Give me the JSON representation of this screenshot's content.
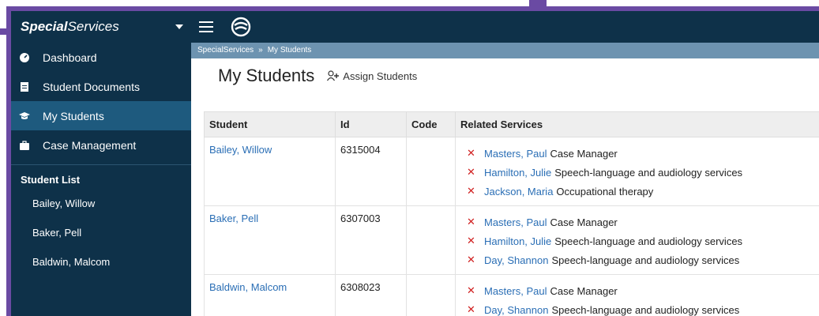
{
  "brand": {
    "name_bold": "Special",
    "name_rest": "Services"
  },
  "sidebar": {
    "items": [
      {
        "label": "Dashboard",
        "icon": "dashboard-icon"
      },
      {
        "label": "Student Documents",
        "icon": "document-icon"
      },
      {
        "label": "My Students",
        "icon": "graduation-cap-icon",
        "active": true
      },
      {
        "label": "Case Management",
        "icon": "briefcase-icon"
      }
    ],
    "list_title": "Student List",
    "students": [
      "Bailey, Willow",
      "Baker, Pell",
      "Baldwin, Malcom"
    ]
  },
  "breadcrumb": {
    "root": "SpecialServices",
    "sep": "»",
    "current": "My Students"
  },
  "page": {
    "title": "My Students",
    "assign_label": "Assign Students"
  },
  "table": {
    "headers": [
      "Student",
      "Id",
      "Code",
      "Related Services"
    ],
    "rows": [
      {
        "student": "Bailey, Willow",
        "id": "6315004",
        "code": "",
        "services": [
          {
            "name": "Masters, Paul",
            "desc": "Case Manager"
          },
          {
            "name": "Hamilton, Julie",
            "desc": "Speech-language and audiology services"
          },
          {
            "name": "Jackson, Maria",
            "desc": "Occupational therapy"
          }
        ]
      },
      {
        "student": "Baker, Pell",
        "id": "6307003",
        "code": "",
        "services": [
          {
            "name": "Masters, Paul",
            "desc": "Case Manager"
          },
          {
            "name": "Hamilton, Julie",
            "desc": "Speech-language and audiology services"
          },
          {
            "name": "Day, Shannon",
            "desc": "Speech-language and audiology services"
          }
        ]
      },
      {
        "student": "Baldwin, Malcom",
        "id": "6308023",
        "code": "",
        "services": [
          {
            "name": "Masters, Paul",
            "desc": "Case Manager"
          },
          {
            "name": "Day, Shannon",
            "desc": "Speech-language and audiology services"
          }
        ]
      }
    ]
  },
  "colors": {
    "navy": "#0e3149",
    "active": "#1e5a7e",
    "breadcrumb": "#6d93b0",
    "link": "#2a6eb5",
    "remove": "#d02020",
    "frame": "#6a4aa3"
  }
}
